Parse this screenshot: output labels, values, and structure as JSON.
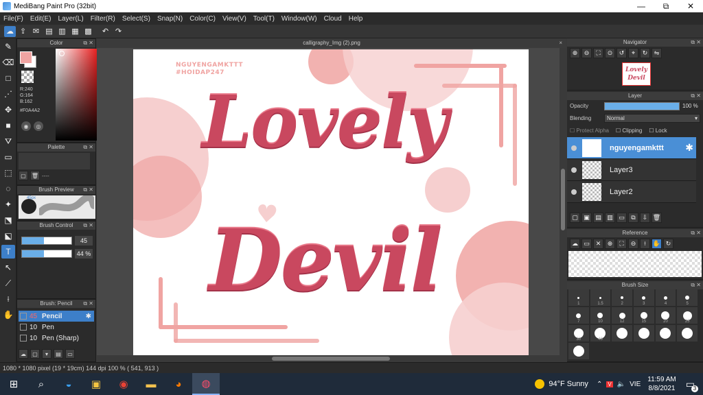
{
  "window": {
    "title": "MediBang Paint Pro (32bit)",
    "minimize": "—",
    "restore": "⧉",
    "close": "✕"
  },
  "menu": [
    "File(F)",
    "Edit(E)",
    "Layer(L)",
    "Filter(R)",
    "Select(S)",
    "Snap(N)",
    "Color(C)",
    "View(V)",
    "Tool(T)",
    "Window(W)",
    "Cloud",
    "Help"
  ],
  "color_panel": {
    "title": "Color",
    "r": "R:240",
    "g": "G:164",
    "b": "B:162",
    "hex": "#F0A4A2",
    "fg_color": "#F0A4A2"
  },
  "palette_panel": {
    "title": "Palette",
    "empty": "----"
  },
  "brush_preview": {
    "title": "Brush Preview",
    "size_label": "45px"
  },
  "brush_control": {
    "title": "Brush Control",
    "size_value": "45",
    "size_fraction": 0.45,
    "opacity_value": "44 %",
    "opacity_fraction": 0.44
  },
  "brush_list": {
    "title": "Brush: Pencil",
    "items": [
      {
        "size": "45",
        "name": "Pencil",
        "selected": true
      },
      {
        "size": "10",
        "name": "Pen",
        "selected": false
      },
      {
        "size": "10",
        "name": "Pen (Sharp)",
        "selected": false
      }
    ]
  },
  "document": {
    "tab_title": "calligraphy_Img (2).png",
    "tab_close": "×"
  },
  "artwork": {
    "watermark_line1": "NGUYENGAMKTTT",
    "watermark_line2": "#HOIDAP247",
    "text_top": "Lovely",
    "text_bottom": "Devil",
    "text_color": "#C9485F",
    "accent_color": "#F0A4A2"
  },
  "navigator": {
    "title": "Navigator",
    "thumb_line1": "Lovely",
    "thumb_line2": "Devil"
  },
  "layer_panel": {
    "title": "Layer",
    "opacity_label": "Opacity",
    "opacity_value": "100 %",
    "opacity_fraction": 1.0,
    "blending_label": "Blending",
    "blending_value": "Normal",
    "protect_alpha": "Protect Alpha",
    "clipping": "Clipping",
    "lock": "Lock",
    "layers": [
      {
        "name": "nguyengamkttt",
        "selected": true
      },
      {
        "name": "Layer3",
        "selected": false
      },
      {
        "name": "Layer2",
        "selected": false
      }
    ]
  },
  "reference_panel": {
    "title": "Reference"
  },
  "brush_size_panel": {
    "title": "Brush Size",
    "sizes": [
      "1",
      "1.5",
      "2",
      "3",
      "4",
      "5",
      "7",
      "10",
      "12",
      "15",
      "20",
      "25",
      "30",
      "40",
      "",
      "",
      "",
      "",
      ""
    ]
  },
  "statusbar": {
    "text": "1080 * 1080 pixel  (19 * 19cm)  144 dpi  100 %  ( 541, 913 )"
  },
  "taskbar": {
    "weather": "94°F  Sunny",
    "lang": "VIE",
    "time": "11:59 AM",
    "date": "8/8/2021",
    "notifications": "3"
  }
}
